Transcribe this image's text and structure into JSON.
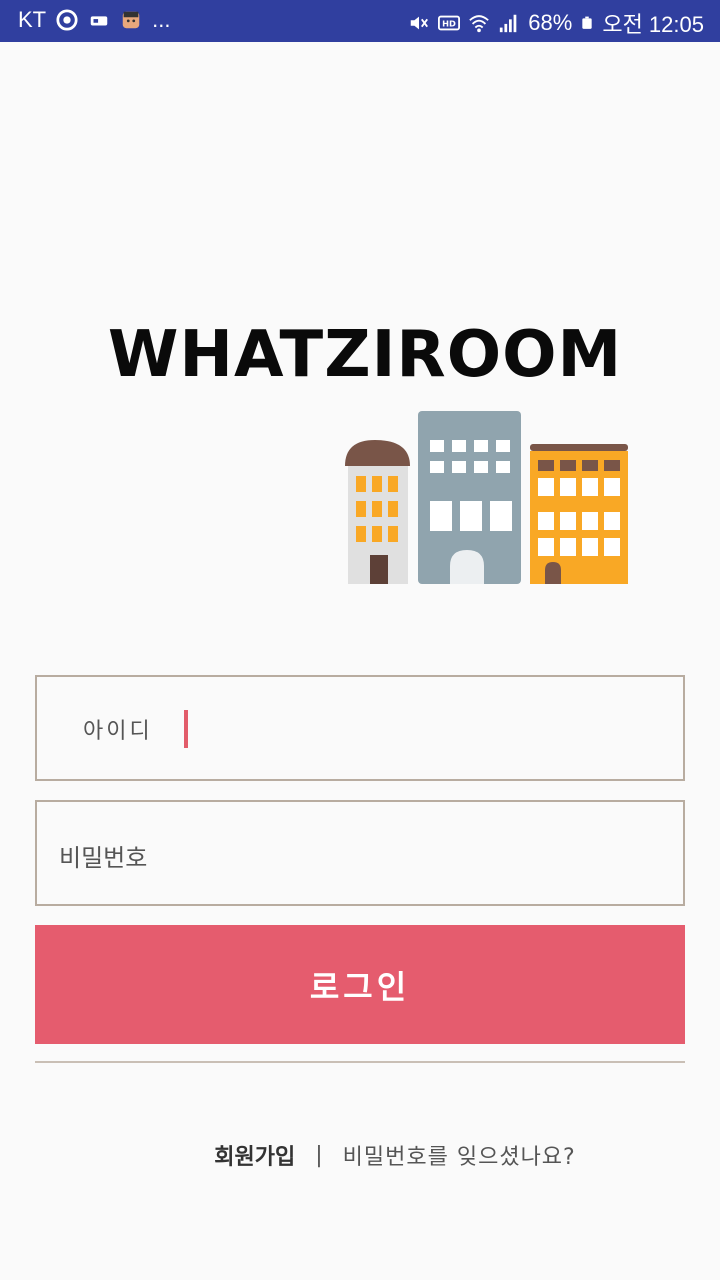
{
  "status_bar": {
    "carrier": "KT",
    "battery": "68%",
    "time": "오전 12:05",
    "icons": [
      "target-icon",
      "badge-icon",
      "character-icon",
      "more-icon",
      "mute-icon",
      "hd-icon",
      "wifi-icon",
      "signal-icon",
      "battery-icon"
    ],
    "more": "..."
  },
  "logo": {
    "text": "WHATZIROOM"
  },
  "form": {
    "id_label": "아이디",
    "password_placeholder": "비밀번호"
  },
  "login_button": {
    "label": "로그인"
  },
  "links": {
    "signup": "회원가입",
    "separator": "|",
    "forgot_password": "비밀번호를 잊으셨나요?"
  },
  "colors": {
    "status_bar": "#303f9f",
    "accent": "#e55c6e",
    "border": "#b8aca0"
  }
}
